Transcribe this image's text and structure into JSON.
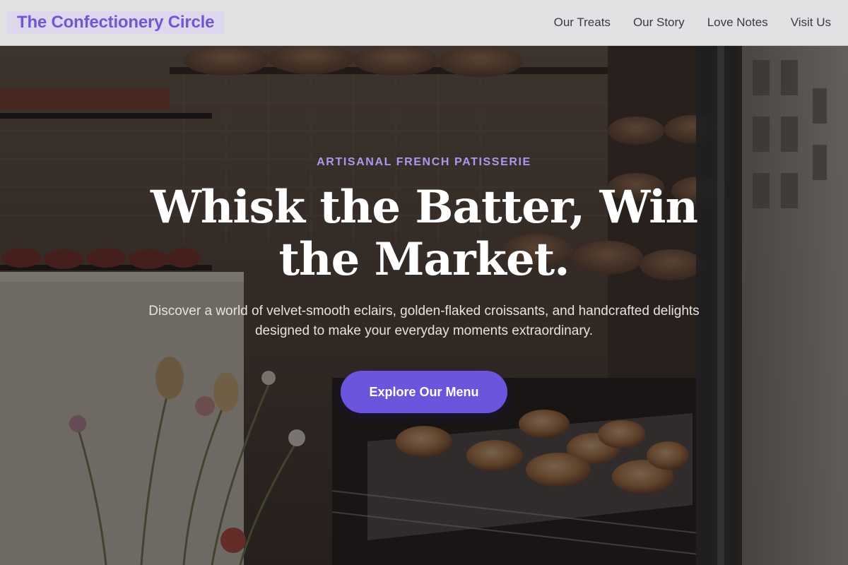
{
  "brand": {
    "name": "The Confectionery Circle"
  },
  "nav": {
    "links": [
      {
        "label": "Our Treats"
      },
      {
        "label": "Our Story"
      },
      {
        "label": "Love Notes"
      },
      {
        "label": "Visit Us"
      }
    ]
  },
  "hero": {
    "eyebrow": "ARTISANAL FRENCH PATISSERIE",
    "headline": "Whisk the Batter, Win the Market.",
    "subtext": "Discover a world of velvet-smooth eclairs, golden-flaked croissants, and handcrafted delights designed to make your everyday moments extraordinary.",
    "cta_label": "Explore Our Menu",
    "background_image": "bakery-window-photo"
  },
  "colors": {
    "brand_accent": "#6f57d6",
    "brand_highlight": "#ddd8ee",
    "eyebrow": "#a999ee",
    "cta_background": "#6a55dc",
    "navbar_background": "#e2e2e4"
  }
}
